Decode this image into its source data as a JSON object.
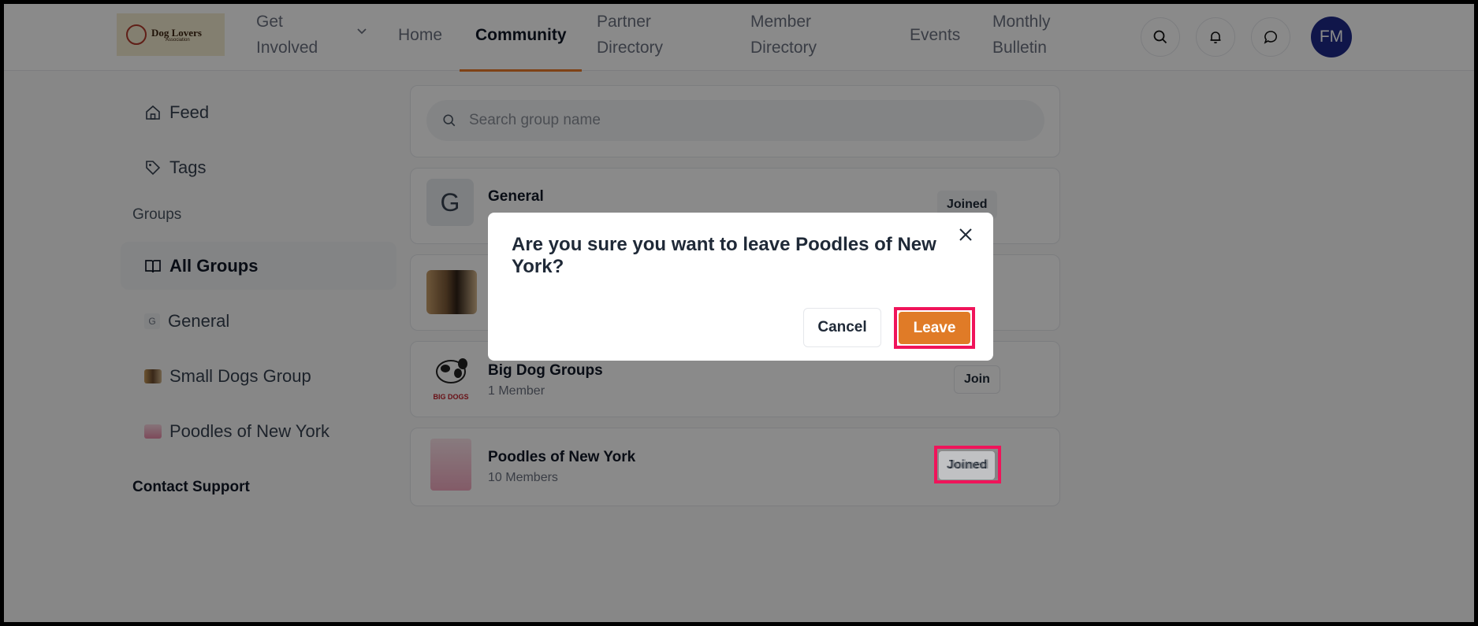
{
  "nav": {
    "logo_text": "Dog Lovers",
    "logo_subtext": "Association",
    "get_involved": [
      "Get",
      "Involved"
    ],
    "home": "Home",
    "community": "Community",
    "partner_directory": [
      "Partner",
      "Directory"
    ],
    "member_directory": [
      "Member",
      "Directory"
    ],
    "events": "Events",
    "monthly_bulletin": [
      "Monthly",
      "Bulletin"
    ],
    "avatar_initials": "FM",
    "icons": [
      "search-icon",
      "bell-icon",
      "chat-icon"
    ],
    "accent_color": "#ea7a2a"
  },
  "sidebar": {
    "feed": "Feed",
    "tags": "Tags",
    "groups_heading": "Groups",
    "all_groups": "All Groups",
    "general_badge": "G",
    "general": "General",
    "small_dogs": "Small Dogs Group",
    "poodles": "Poodles of New York",
    "contact_support": "Contact Support"
  },
  "search": {
    "placeholder": "Search group name"
  },
  "groups": [
    {
      "thumb_letter": "G",
      "name": "General",
      "meta": "",
      "button": "Joined"
    },
    {
      "name": "Big Dog Groups",
      "meta": "1 Member",
      "button": "Join",
      "thumb_label": "BIG DOGS"
    },
    {
      "name": "Poodles of New York",
      "meta": "10 Members",
      "button": "Joined"
    }
  ],
  "modal": {
    "title": "Are you sure you want to leave Poodles of New York?",
    "cancel": "Cancel",
    "leave": "Leave",
    "leave_color": "#e07b27"
  },
  "highlight_color": "#f0145a"
}
